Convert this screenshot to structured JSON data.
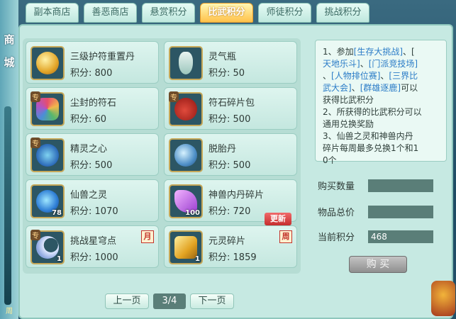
{
  "side": {
    "label": "商城",
    "bottom_text": "周"
  },
  "tabs": [
    {
      "label": "副本商店",
      "active": false
    },
    {
      "label": "善恶商店",
      "active": false
    },
    {
      "label": "悬赏积分",
      "active": false
    },
    {
      "label": "比武积分",
      "active": true
    },
    {
      "label": "师徒积分",
      "active": false
    },
    {
      "label": "挑战积分",
      "active": false
    }
  ],
  "points_label": "积分:",
  "items": [
    {
      "name": "三级护符重置丹",
      "points": "800",
      "icon": "amulet-reset-icon",
      "special": false,
      "count": "",
      "tag": ""
    },
    {
      "name": "灵气瓶",
      "points": "50",
      "icon": "spirit-bottle-icon",
      "special": false,
      "count": "",
      "tag": ""
    },
    {
      "name": "尘封的符石",
      "points": "60",
      "icon": "sealed-rune-icon",
      "special": true,
      "count": "",
      "tag": ""
    },
    {
      "name": "符石碎片包",
      "points": "500",
      "icon": "rune-shard-pack-icon",
      "special": true,
      "count": "",
      "tag": ""
    },
    {
      "name": "精灵之心",
      "points": "500",
      "icon": "spirit-heart-icon",
      "special": true,
      "count": "",
      "tag": ""
    },
    {
      "name": "脱胎丹",
      "points": "500",
      "icon": "rebirth-pill-icon",
      "special": false,
      "count": "",
      "tag": ""
    },
    {
      "name": "仙兽之灵",
      "points": "1070",
      "icon": "beast-soul-icon",
      "special": false,
      "count": "78",
      "tag": ""
    },
    {
      "name": "神兽内丹碎片",
      "points": "720",
      "icon": "beast-core-shard-icon",
      "special": false,
      "count": "100",
      "tag": ""
    },
    {
      "name": "挑战星穹点",
      "points": "1000",
      "icon": "star-dome-icon",
      "special": true,
      "count": "1",
      "tag": "月"
    },
    {
      "name": "元灵碎片",
      "points": "1859",
      "icon": "yuanling-shard-icon",
      "special": false,
      "count": "1",
      "tag": "周"
    }
  ],
  "badges": {
    "special": "专",
    "update": "更新"
  },
  "pager": {
    "prev": "上一页",
    "page": "3/4",
    "next": "下一页"
  },
  "info": {
    "l1a": "1、参加",
    "l1b": "[生存大挑战]",
    "l1c": "、[",
    "l2a": "天地乐斗]",
    "l2b": "、",
    "l2c": "[门派竞技场]",
    "l3a": "、",
    "l3b": "[人物排位赛]",
    "l3c": "、",
    "l3d": "[三界比",
    "l4a": "武大会]",
    "l4b": "、",
    "l4c": "[群雄逐鹿]",
    "l4d": "可以",
    "l5": "获得比武积分",
    "l6": "2、所获得的比武积分可以",
    "l7": "通用兑换奖励",
    "l8": "3、仙兽之灵和神兽内丹",
    "l9": "碎片每周最多兑换1个和1",
    "l10": "0个"
  },
  "fields": {
    "qty_label": "购买数量",
    "qty_value": "",
    "total_label": "物品总价",
    "total_value": "",
    "current_label": "当前积分",
    "current_value": "468"
  },
  "buy_button": "购 买",
  "colors": {
    "active_tab": "#ffc24a",
    "panel": "#c6e9e2",
    "highlight_text": "#2b7cc7"
  }
}
